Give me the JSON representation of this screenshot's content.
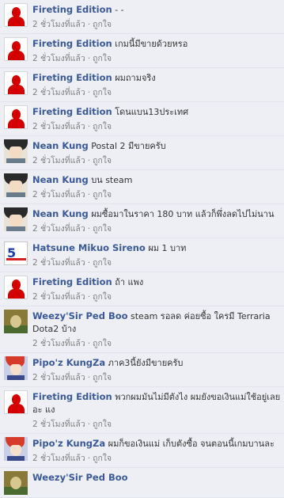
{
  "like_label": "ถูกใจ",
  "separator": "·",
  "comments": [
    {
      "author": "Fireting Edition",
      "text": "- -",
      "time": "2 ชั่วโมงที่แล้ว",
      "avatar": "red-silhouette"
    },
    {
      "author": "Fireting Edition",
      "text": "เกมนี้มีขายด้วยหรอ",
      "time": "2 ชั่วโมงที่แล้ว",
      "avatar": "red-silhouette"
    },
    {
      "author": "Fireting Edition",
      "text": "ผมถามจริง",
      "time": "2 ชั่วโมงที่แล้ว",
      "avatar": "red-silhouette"
    },
    {
      "author": "Fireting Edition",
      "text": "โดนแบน13ประเทศ",
      "time": "2 ชั่วโมงที่แล้ว",
      "avatar": "red-silhouette"
    },
    {
      "author": "Nean Kung",
      "text": "Postal 2 มีขายครับ",
      "time": "2 ชั่วโมงที่แล้ว",
      "avatar": "anime-boy"
    },
    {
      "author": "Nean Kung",
      "text": "บน steam",
      "time": "2 ชั่วโมงที่แล้ว",
      "avatar": "anime-boy"
    },
    {
      "author": "Nean Kung",
      "text": "ผมซื้อมาในราคา 180 บาท แล้วก็พึ่งลดไปไม่นาน",
      "time": "2 ชั่วโมงที่แล้ว",
      "avatar": "anime-boy"
    },
    {
      "author": "Hatsune Mikuo Sireno",
      "text": "ผม 1 บาท",
      "time": "2 ชั่วโมงที่แล้ว",
      "avatar": "hatsune"
    },
    {
      "author": "Fireting Edition",
      "text": "ถ้า แพง",
      "time": "2 ชั่วโมงที่แล้ว",
      "avatar": "red-silhouette"
    },
    {
      "author": "Weezy'Sir Ped Boo",
      "text": "steam รอลด ค่อยซื้อ ใครมี Terraria Dota2 บ้าง",
      "time": "2 ชั่วโมงที่แล้ว",
      "avatar": "weezy"
    },
    {
      "author": "Pipo'z KungZa",
      "text": "ภาค3นี้ยังมีขายครับ",
      "time": "2 ชั่วโมงที่แล้ว",
      "avatar": "pipo"
    },
    {
      "author": "Fireting Edition",
      "text": "พวกผมมันไม่มีตังไง ผมยังขอเงินแม่ใช้อยู่เลยอะ แง",
      "time": "2 ชั่วโมงที่แล้ว",
      "avatar": "red-silhouette"
    },
    {
      "author": "Pipo'z KungZa",
      "text": "ผมก็ขอเงินแม่ เก็บตังซื้อ จนตอนนี้เกมบานละ",
      "time": "2 ชั่วโมงที่แล้ว",
      "avatar": "pipo"
    },
    {
      "author": "Weezy'Sir Ped Boo",
      "text": "",
      "time": "",
      "avatar": "weezy"
    }
  ]
}
